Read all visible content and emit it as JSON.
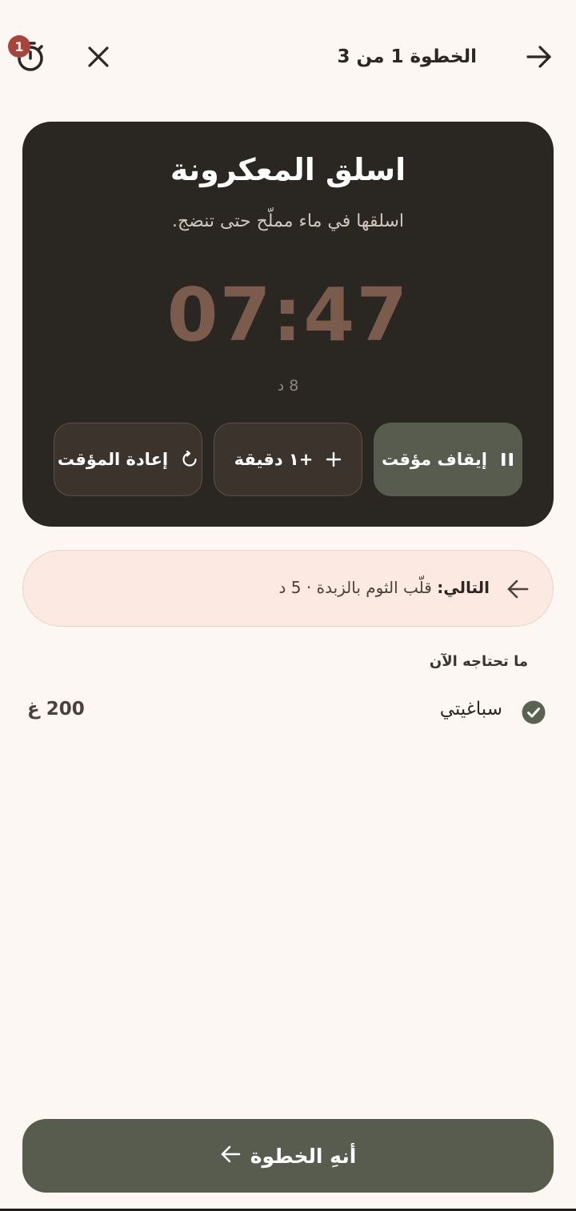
{
  "header": {
    "timer_badge": "1",
    "step_label": "الخطوة 1 من 3"
  },
  "card": {
    "title": "اسلق المعكرونة",
    "subtitle": "اسلقها في ماء مملّح حتى تنضج.",
    "timer": "07:47",
    "total": "8 د",
    "pause_label": "إيقاف مؤقت",
    "add_label": "+١ دقيقة",
    "reset_label": "إعادة المؤقت"
  },
  "next": {
    "prefix": "التالي:",
    "text": "قلّب الثوم بالزبدة · 5 د"
  },
  "ingredients": {
    "heading": "ما تحتاجه الآن",
    "items": [
      {
        "name": "سباغيتي",
        "qty": "200 غ",
        "checked": true
      }
    ]
  },
  "footer": {
    "finish_label": "أنهِ الخطوة"
  },
  "colors": {
    "background": "#FCF7F2",
    "card": "#2A2621",
    "timer": "#7A5B4C",
    "accent": "#585C4E",
    "badge": "#A8443A",
    "next_bg": "#FCE9E2"
  },
  "icons": [
    "stopwatch-icon",
    "close-icon",
    "arrow-right-icon",
    "pause-icon",
    "plus-icon",
    "restart-icon",
    "arrow-left-icon",
    "check-circle-icon"
  ]
}
